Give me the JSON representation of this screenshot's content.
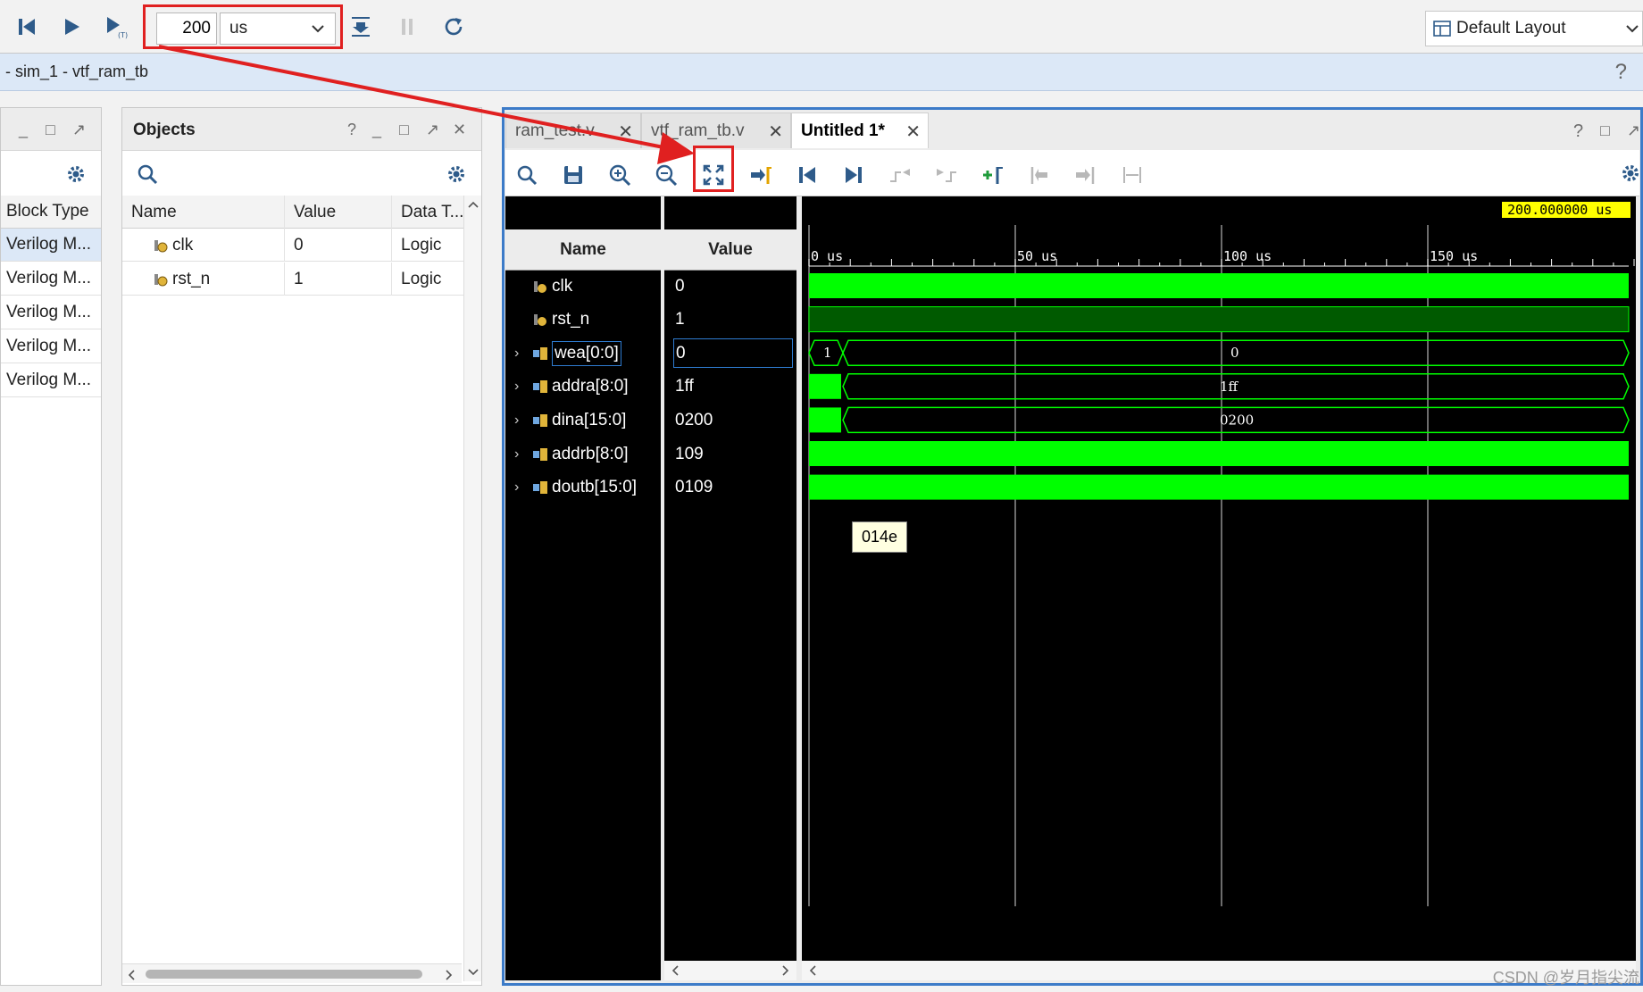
{
  "toolbar": {
    "time_value": "200",
    "time_unit": "us",
    "layout_label": "Default Layout"
  },
  "breadcrumb": "- sim_1 - vtf_ram_tb",
  "left_panel": {
    "column_header": "Block Type",
    "items": [
      "Verilog M...",
      "Verilog M...",
      "Verilog M...",
      "Verilog M...",
      "Verilog M..."
    ]
  },
  "objects_panel": {
    "title": "Objects",
    "columns": [
      "Name",
      "Value",
      "Data T..."
    ],
    "rows": [
      {
        "name": "clk",
        "value": "0",
        "type": "Logic"
      },
      {
        "name": "rst_n",
        "value": "1",
        "type": "Logic"
      }
    ]
  },
  "wave_window": {
    "tabs": [
      {
        "label": "ram_test.v"
      },
      {
        "label": "vtf_ram_tb.v"
      },
      {
        "label": "Untitled 1*"
      }
    ],
    "name_header": "Name",
    "value_header": "Value",
    "cursor_time": "200.000000 us",
    "time_ticks": [
      "0 us",
      "50 us",
      "100 us",
      "150 us"
    ],
    "signals": [
      {
        "name": "clk",
        "value": "0",
        "bus": false
      },
      {
        "name": "rst_n",
        "value": "1",
        "bus": false
      },
      {
        "name": "wea[0:0]",
        "value": "0",
        "bus": true,
        "wave_start_label": "1",
        "wave_label": "0"
      },
      {
        "name": "addra[8:0]",
        "value": "1ff",
        "bus": true,
        "wave_label": "1ff"
      },
      {
        "name": "dina[15:0]",
        "value": "0200",
        "bus": true,
        "wave_label": "0200"
      },
      {
        "name": "addrb[8:0]",
        "value": "109",
        "bus": true
      },
      {
        "name": "doutb[15:0]",
        "value": "0109",
        "bus": true
      }
    ],
    "tooltip": "014e"
  },
  "watermark": "CSDN @岁月指尖流",
  "colors": {
    "wave": "#00ff00",
    "accent_red": "#e02020",
    "panel_border": "#3c7bc8"
  }
}
